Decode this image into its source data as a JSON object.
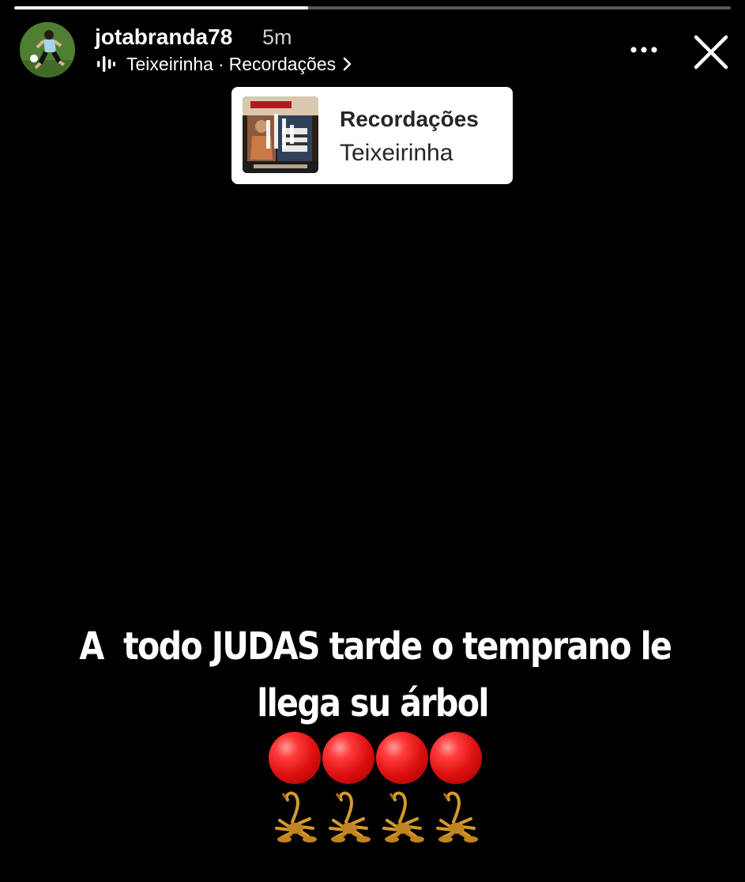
{
  "story": {
    "progress_fraction": 0.41,
    "username": "jotabranda78",
    "time": "5m",
    "music": {
      "artist": "Teixeirinha",
      "separator": "·",
      "song": "Recordações"
    }
  },
  "sticker": {
    "title": "Recordações",
    "artist": "Teixeirinha"
  },
  "caption": {
    "line1": "A  todo JUDAS tarde o temprano le",
    "line2": "llega su árbol"
  },
  "icons": {
    "more": "more-dots-icon",
    "close": "close-icon",
    "audio": "audio-wave-icon",
    "chevron": "chevron-right-icon",
    "circles": [
      "red-circle-icon",
      "red-circle-icon",
      "red-circle-icon",
      "red-circle-icon"
    ],
    "scorpions": [
      "scorpion-icon",
      "scorpion-icon",
      "scorpion-icon",
      "scorpion-icon"
    ]
  },
  "colors": {
    "background": "#000000",
    "text": "#ffffff",
    "sticker_background": "#ffffff",
    "sticker_text": "#262626"
  }
}
